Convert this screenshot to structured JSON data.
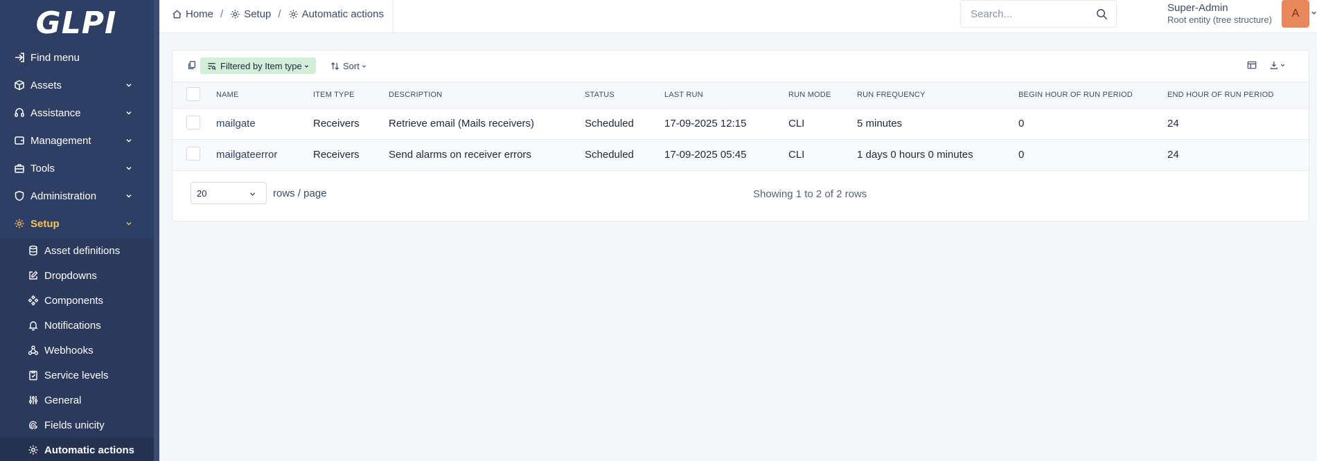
{
  "app": {
    "logo": "GLPI"
  },
  "sidebar": {
    "find_menu": "Find menu",
    "items": [
      {
        "label": "Assets",
        "icon": "cube-icon"
      },
      {
        "label": "Assistance",
        "icon": "headset-icon"
      },
      {
        "label": "Management",
        "icon": "wallet-icon"
      },
      {
        "label": "Tools",
        "icon": "briefcase-icon"
      },
      {
        "label": "Administration",
        "icon": "shield-icon"
      },
      {
        "label": "Setup",
        "icon": "gear-icon"
      }
    ],
    "submenu": [
      {
        "label": "Asset definitions",
        "icon": "database-icon"
      },
      {
        "label": "Dropdowns",
        "icon": "edit-icon"
      },
      {
        "label": "Components",
        "icon": "components-icon"
      },
      {
        "label": "Notifications",
        "icon": "bell-icon"
      },
      {
        "label": "Webhooks",
        "icon": "webhook-icon"
      },
      {
        "label": "Service levels",
        "icon": "clipboard-icon"
      },
      {
        "label": "General",
        "icon": "adjustments-icon"
      },
      {
        "label": "Fields unicity",
        "icon": "fingerprint-icon"
      },
      {
        "label": "Automatic actions",
        "icon": "gear-icon"
      }
    ]
  },
  "header": {
    "breadcrumb": [
      "Home",
      "Setup",
      "Automatic actions"
    ],
    "search_placeholder": "Search...",
    "user_name": "Super-Admin",
    "user_entity": "Root entity (tree structure)",
    "avatar_initial": "A"
  },
  "toolbar": {
    "filter_label": "Filtered by Item type",
    "sort_label": "Sort"
  },
  "table": {
    "columns": [
      "NAME",
      "ITEM TYPE",
      "DESCRIPTION",
      "STATUS",
      "LAST RUN",
      "RUN MODE",
      "RUN FREQUENCY",
      "BEGIN HOUR OF RUN PERIOD",
      "END HOUR OF RUN PERIOD"
    ],
    "rows": [
      [
        "mailgate",
        "Receivers",
        "Retrieve email (Mails receivers)",
        "Scheduled",
        "17-09-2025 12:15",
        "CLI",
        "5 minutes",
        "0",
        "24"
      ],
      [
        "mailgateerror",
        "Receivers",
        "Send alarms on receiver errors",
        "Scheduled",
        "17-09-2025 05:45",
        "CLI",
        "1 days 0 hours 0 minutes",
        "0",
        "24"
      ]
    ]
  },
  "pager": {
    "rows_per_page": "20",
    "rows_label": "rows / page",
    "showing": "Showing 1 to 2 of 2 rows"
  },
  "colors": {
    "sidebar_bg": "#2f3f64",
    "active_menu": "#fbc15b",
    "filter_badge": "#d3efd9",
    "avatar": "#e9875c"
  }
}
